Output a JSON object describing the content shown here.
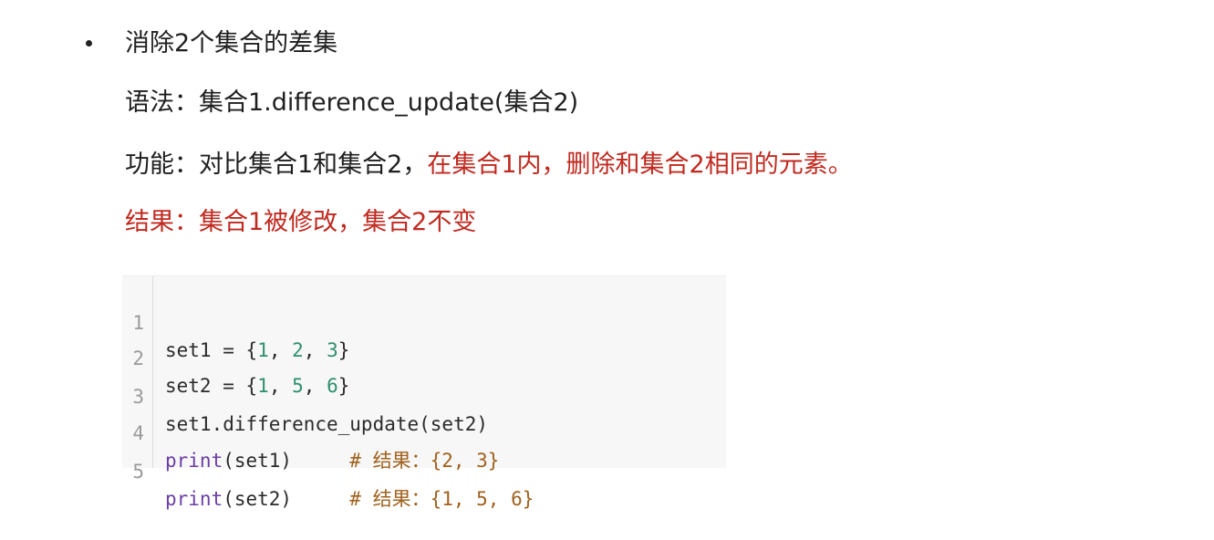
{
  "bullet": {
    "title": "消除2个集合的差集"
  },
  "syntax": {
    "text": "语法：集合1.difference_update(集合2)"
  },
  "function": {
    "prefix": "功能：对比集合1和集合2，",
    "highlight": "在集合1内，删除和集合2相同的元素。"
  },
  "result": {
    "text": "结果：集合1被修改，集合2不变"
  },
  "code": {
    "lines": [
      {
        "number": "1",
        "text": "set1 = {1, 2, 3}"
      },
      {
        "number": "2",
        "text": "set2 = {1, 5, 6}"
      },
      {
        "number": "3",
        "text": "set1.difference_update(set2)"
      },
      {
        "number": "4",
        "text": "print(set1)     # 结果：{2, 3}"
      },
      {
        "number": "5",
        "text": "print(set2)     # 结果：{1, 5, 6}"
      }
    ]
  }
}
